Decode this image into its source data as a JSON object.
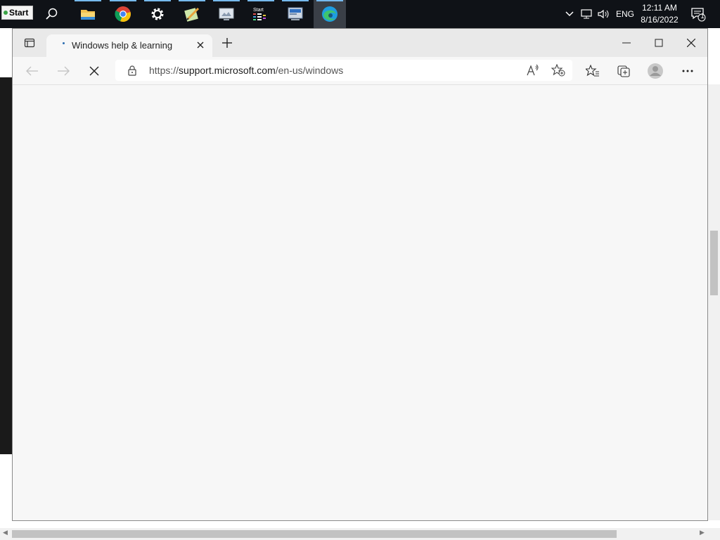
{
  "taskbar": {
    "start_label": "Start",
    "icons": [
      "search-icon",
      "file-explorer-icon",
      "chrome-icon",
      "settings-gear-icon",
      "notepad-pen-icon",
      "paint-icon",
      "start-menu-app-icon",
      "control-panel-icon",
      "edge-icon"
    ],
    "language": "ENG",
    "time": "12:11 AM",
    "date": "8/16/2022",
    "notification_count": "1"
  },
  "browser": {
    "tab_title": "Windows help & learning",
    "url_prefix": "https://",
    "url_domain": "support.microsoft.com",
    "url_path": "/en-us/windows",
    "loading": true
  },
  "colors": {
    "taskbar": "#0f1217",
    "accent": "#76b9ed",
    "page_bg": "#f7f7f7"
  }
}
